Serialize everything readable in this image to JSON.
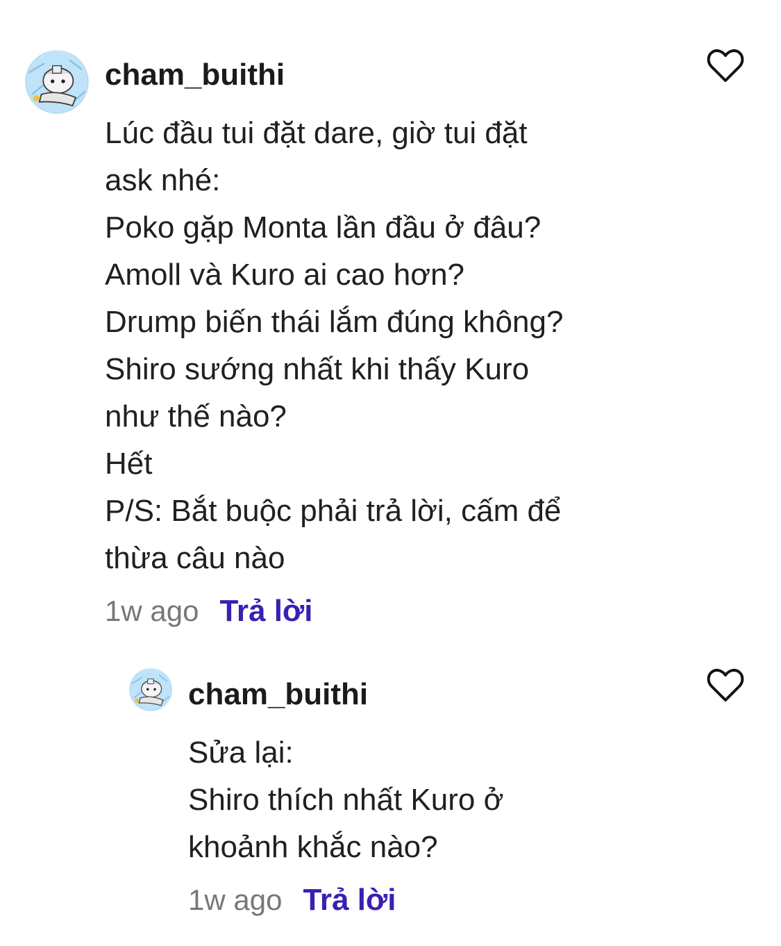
{
  "comments": [
    {
      "username": "cham_buithi",
      "lines": [
        "Lúc đầu tui đặt dare, giờ tui đặt",
        "ask nhé:",
        "Poko gặp Monta lần đầu ở đâu?",
        "Amoll và Kuro ai cao hơn?",
        "Drump biến thái lắm đúng không?",
        "Shiro sướng nhất khi thấy Kuro",
        "như thế nào?",
        "Hết",
        "P/S: Bắt buộc phải trả lời, cấm để",
        "thừa câu nào"
      ],
      "time": "1w ago",
      "reply_label": "Trả lời",
      "avatar_icon": "avatar-image",
      "like_icon": "heart-outline-icon"
    },
    {
      "username": "cham_buithi",
      "lines": [
        "Sửa lại:",
        "Shiro thích nhất Kuro ở",
        "khoảnh khắc nào?"
      ],
      "time": "1w ago",
      "reply_label": "Trả lời",
      "avatar_icon": "avatar-image",
      "like_icon": "heart-outline-icon"
    }
  ],
  "colors": {
    "background": "#ffffff",
    "text": "#202020",
    "timestamp": "#777777",
    "reply_link": "#3b1fb3"
  }
}
